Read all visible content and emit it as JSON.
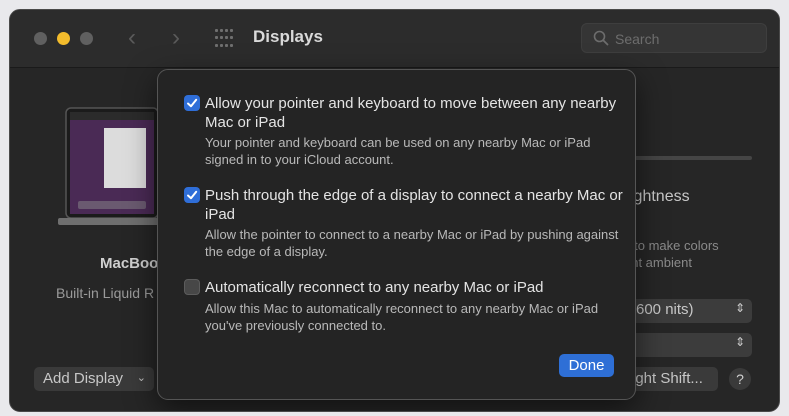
{
  "window": {
    "title": "Displays",
    "search_placeholder": "Search"
  },
  "background": {
    "display_name": "MacBoo",
    "display_sub": "Built-in Liquid R",
    "brightness_label": "ightness",
    "brightness_desc_1": "y to make colors",
    "brightness_desc_2": "ent ambient",
    "refresh_select": "600 nits)",
    "second_select": "",
    "add_display_label": "Add Display",
    "night_shift_label": "ight Shift...",
    "help_label": "?"
  },
  "sheet": {
    "options": [
      {
        "checked": true,
        "label": "Allow your pointer and keyboard to move between any nearby Mac or iPad",
        "description": "Your pointer and keyboard can be used on any nearby Mac or iPad signed in to your iCloud account."
      },
      {
        "checked": true,
        "label": "Push through the edge of a display to connect a nearby Mac or iPad",
        "description": "Allow the pointer to connect to a nearby Mac or iPad by pushing against the edge of a display."
      },
      {
        "checked": false,
        "label": "Automatically reconnect to any nearby Mac or iPad",
        "description": "Allow this Mac to automatically reconnect to any nearby Mac or iPad you've previously connected to."
      }
    ],
    "done_label": "Done"
  },
  "colors": {
    "accent": "#2f6ed8",
    "window_bg": "#262626",
    "traffic_minimize": "#f3bc2c"
  }
}
